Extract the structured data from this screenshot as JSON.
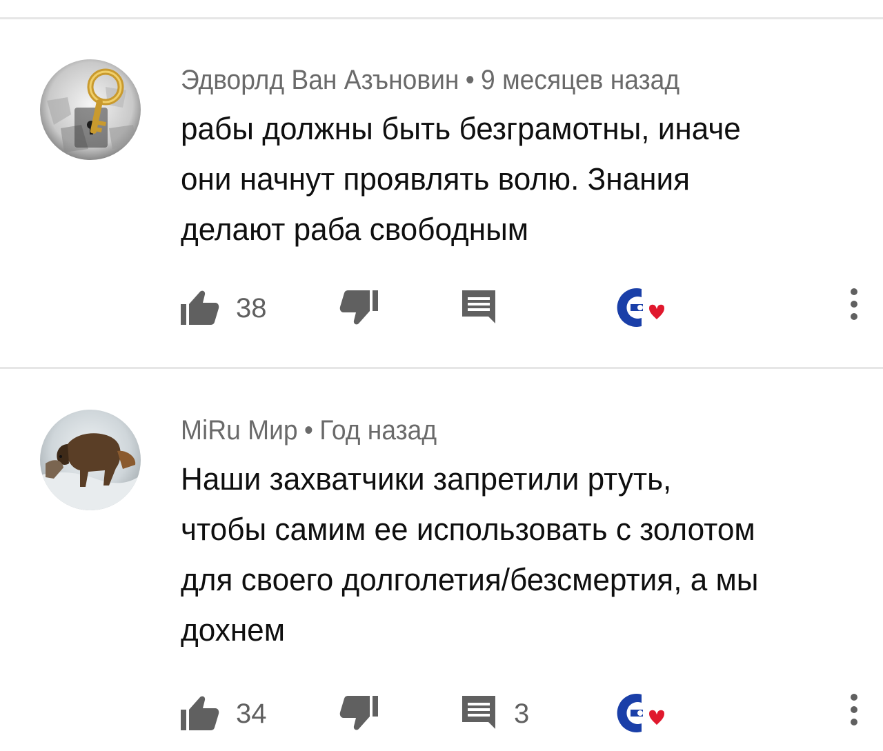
{
  "comments": [
    {
      "author": "Эдворлд Ван Азъновин",
      "separator": "•",
      "time": "9 месяцев назад",
      "lines": [
        "рабы должны быть безграмотны, иначе",
        "они начнут проявлять волю. Знания",
        "делают раба свободным"
      ],
      "likes": "38",
      "replies": "",
      "avatar_icon": "golden-key-icon",
      "icons": [
        "thumbs-up-icon",
        "thumbs-down-icon",
        "reply-icon",
        "heart-badge-icon",
        "more-vert-icon"
      ]
    },
    {
      "author": "MiRu Мир",
      "separator": "•",
      "time": "Год назад",
      "lines": [
        "Наши захватчики запретили ртуть,",
        "чтобы самим ее использовать с золотом",
        "для своего долголетия/безсмертия, а мы",
        "дохнем"
      ],
      "likes": "34",
      "replies": "3",
      "avatar_icon": "bison-painting-icon",
      "icons": [
        "thumbs-up-icon",
        "thumbs-down-icon",
        "reply-icon",
        "heart-badge-icon",
        "more-vert-icon"
      ]
    }
  ],
  "colors": {
    "text": "#0f0f0f",
    "meta": "#6a6a6a",
    "icon": "#606060",
    "badge_blue": "#1a3fa8",
    "heart_red": "#e0182d",
    "divider": "#e6e6e6"
  }
}
